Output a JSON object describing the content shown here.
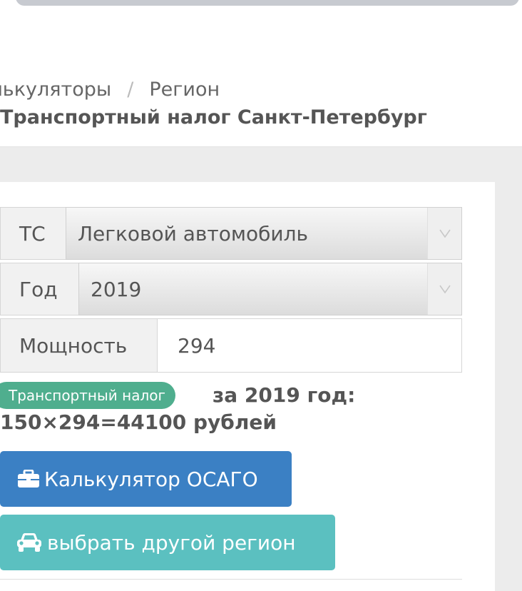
{
  "breadcrumb": {
    "item1": "алькуляторы",
    "separator": "/",
    "item2": "Регион"
  },
  "page_title": "Транспортный налог Санкт-Петербург",
  "form": {
    "vehicle": {
      "label": "ТС",
      "value": "Легковой автомобиль",
      "arrow": "▽"
    },
    "year": {
      "label": "Год",
      "value": "2019",
      "arrow": "▽"
    },
    "power": {
      "label": "Мощность",
      "value": "294"
    }
  },
  "result": {
    "badge": "Транспортный налог",
    "year_text": "за 2019 год:",
    "calc": "150×294=44100 рублей"
  },
  "buttons": {
    "osago": "Калькулятор ОСАГО",
    "region": "выбрать другой регион"
  },
  "icons": {
    "osago": "briefcase-icon",
    "region": "car-icon",
    "select_arrow": "chevron-down-icon"
  },
  "colors": {
    "primary": "#3b80c4",
    "info": "#5bc0c0",
    "badge": "#4fae8e"
  }
}
